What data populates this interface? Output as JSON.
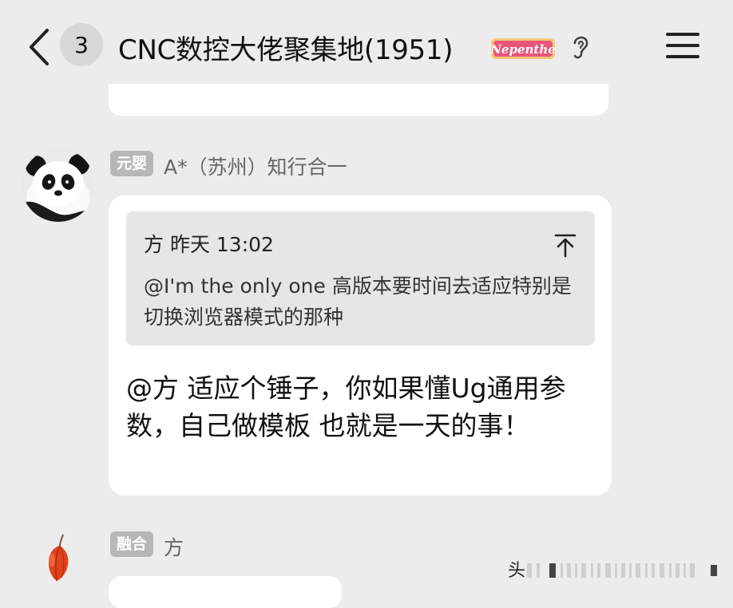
{
  "header": {
    "unread_count": "3",
    "title": "CNC数控大佬聚集地(1951)",
    "badge_text": "Nepenthe"
  },
  "messages": [
    {
      "sender_tag": "元婴",
      "sender_name": "A*（苏州）知行合一",
      "quote": {
        "author_time": "方 昨天 13:02",
        "text": "@I'm the only one 高版本要时间去适应特别是切换浏览器模式的那种"
      },
      "text": "@方 适应个锤子，你如果懂Ug通用参数，自己做模板 也就是一天的事！"
    },
    {
      "sender_tag": "融合",
      "sender_name": "方"
    }
  ],
  "watermark": {
    "text": "头"
  },
  "colors": {
    "background": "#ececec",
    "bubble": "#ffffff",
    "quote_bg": "#e6e6e6",
    "tag_bg": "#b7b7b7"
  }
}
